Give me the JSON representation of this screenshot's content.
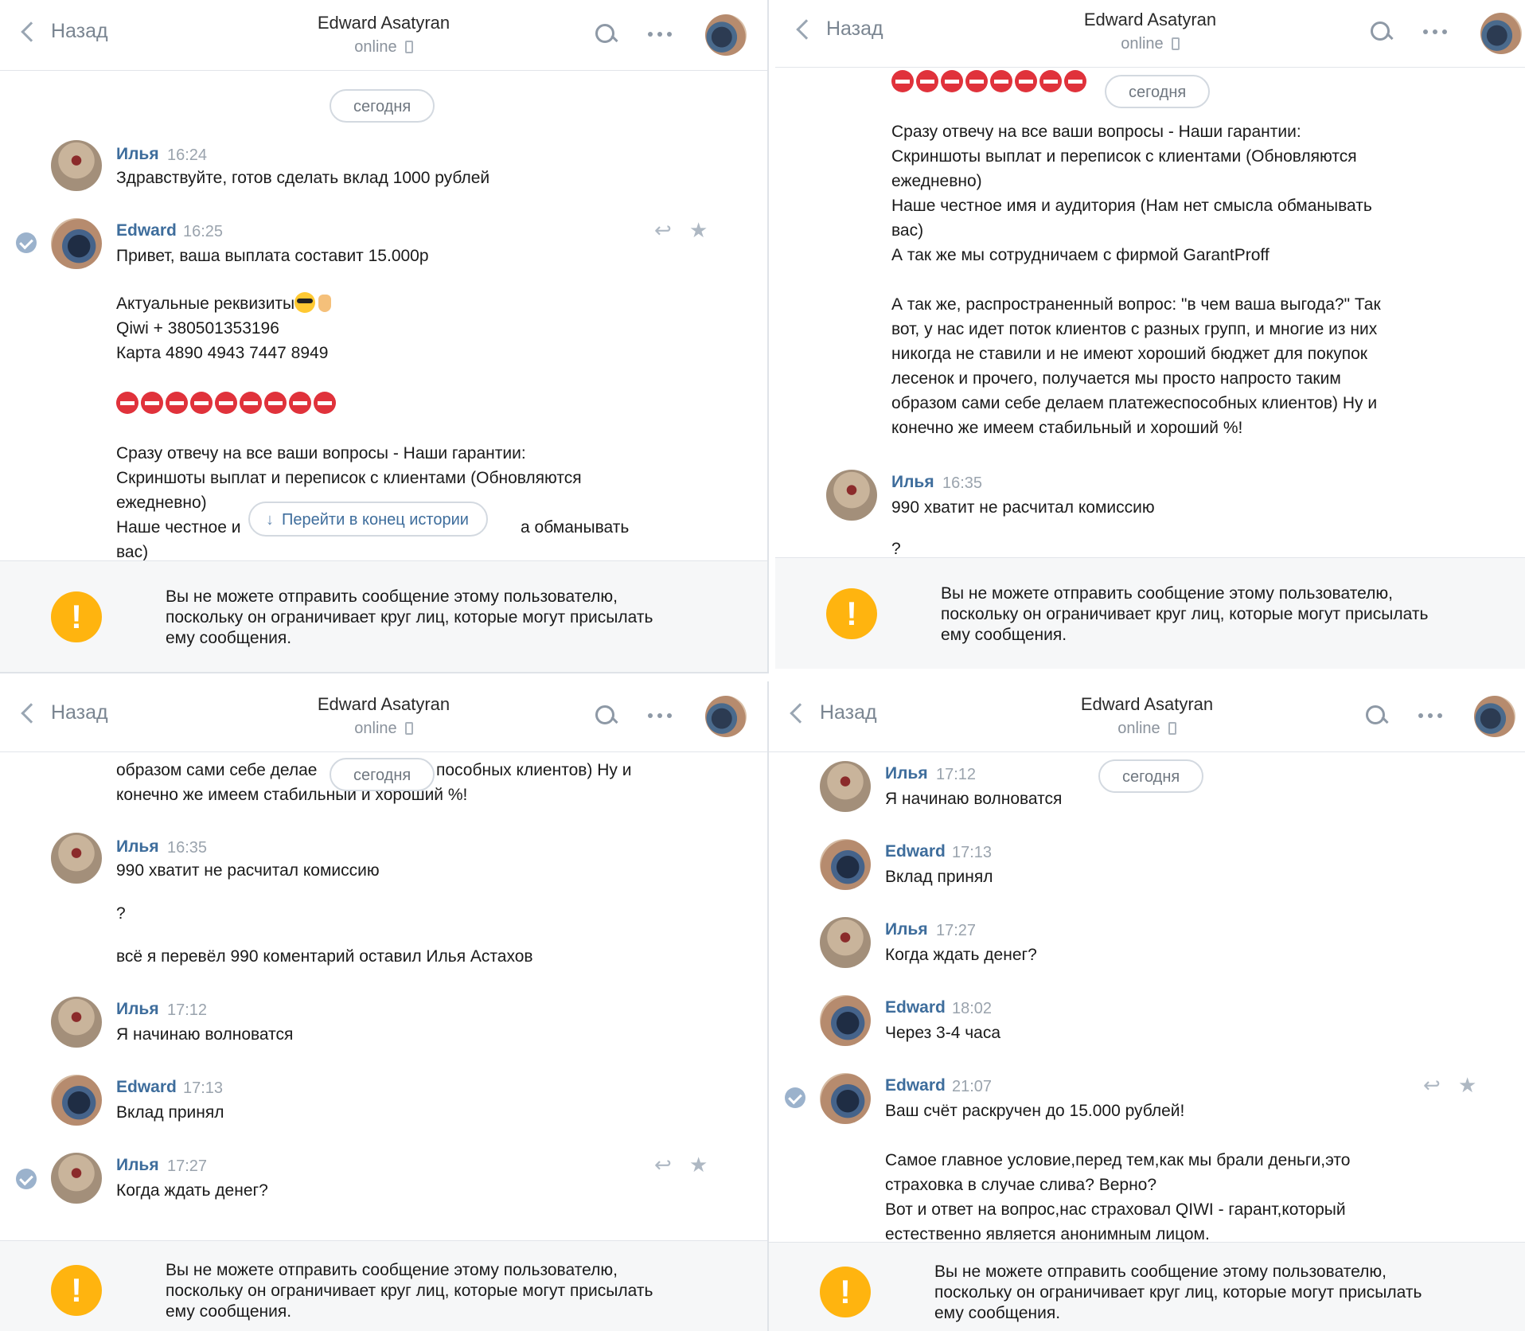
{
  "header": {
    "back_label": "Назад",
    "title": "Edward Asatyran",
    "status": "online"
  },
  "date_pill": "сегодня",
  "goto_end_label": "Перейти в конец истории",
  "notice": "Вы не можете отправить сообщение этому пользователю,\nпоскольку он ограничивает круг лиц, которые могут присылать\nему сообщения.",
  "messages": {
    "m1": {
      "author": "Илья",
      "time": "16:24",
      "text": "Здравствуйте, готов сделать вклад 1000 рублей"
    },
    "m2": {
      "author": "Edward",
      "time": "16:25",
      "line1": "Привет, ваша выплата составит 15.000р",
      "line2": "Актуальные реквизиты",
      "line3": "Qiwi + 380501353196",
      "line4": "Карта 4890 4943 7447 8949",
      "stop_count": 9,
      "guarantees": "Сразу отвечу на все ваши вопросы - Наши гарантии:\nСкриншоты выплат и переписок с клиентами (Обновляются\nежедневно)\nНаше честное имя и аудитория (Нам нет смысла обманывать\nвас)\nА так же мы сотрудничаем с фирмой GarantProff",
      "benefit": "А так же, распространенный вопрос: \"в чем ваша выгода?\" Так\nвот, у нас идет поток клиентов с разных групп, и многие из них\nникогда не ставили и не имеют хороший бюджет для покупок\nлесенок и прочего, получается мы просто напросто таким\nобразом сами себе делаем платежеспособных клиентов) Ну и\nконечно же имеем стабильный и хороший %!"
    },
    "m3": {
      "author": "Илья",
      "time": "16:35",
      "line1": "990 хватит не расчитал комиссию",
      "line2": "?",
      "line3": "всё я перевёл 990 коментарий оставил Илья Астахов"
    },
    "m4": {
      "author": "Илья",
      "time": "17:12",
      "text": "Я начинаю волноватся"
    },
    "m5": {
      "author": "Edward",
      "time": "17:13",
      "text": "Вклад принял"
    },
    "m6": {
      "author": "Илья",
      "time": "17:27",
      "text": "Когда ждать денег?"
    },
    "m7": {
      "author": "Edward",
      "time": "18:02",
      "text": "Через 3-4 часа"
    },
    "m8": {
      "author": "Edward",
      "time": "21:07",
      "line1": "Ваш счёт раскручен до 15.000 рублей!",
      "line2": "Самое главное условие,перед тем,как мы брали деньги,это\nстраховка в случае слива? Верно?\nВот и ответ на вопрос,нас страховал QIWI - гарант,который\nестественно является анонимным лицом."
    }
  },
  "panel1_text": {
    "p0_guarantees_tail": "ежедневно)\nНаше честное и",
    "p0_guarantees_right": "а обманывать",
    "p0_guarantees_last": "вас)",
    "p2_tail_line1": "образом сами себе делае",
    "p2_tail_line1_right": "пособных клиентов) Ну и",
    "p2_tail_line2": "конечно же имеем стабильный и хороший %!",
    "p0_guarantee_head": "Сразу отвечу на все ваши вопросы - Наши гарантии:\nСкриншоты выплат и переписок с клиентами (Обновляются"
  },
  "colors": {
    "accent": "#3e6d9c",
    "warning": "#ffb40f",
    "stop": "#e0323b"
  }
}
